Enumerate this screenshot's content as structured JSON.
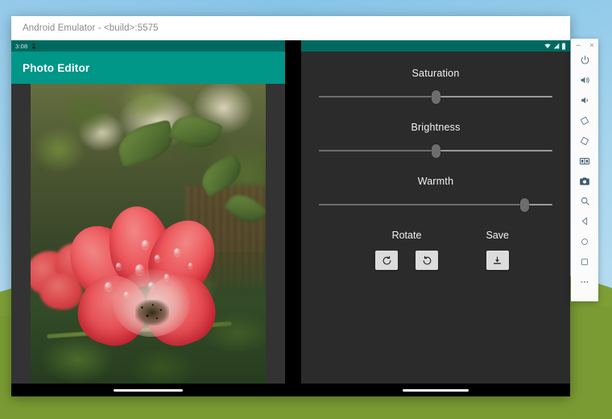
{
  "window": {
    "title": "Android Emulator - <build>:5575"
  },
  "android_status_bar": {
    "clock": "3:08",
    "left_icons": [
      "debug-bridge-icon"
    ],
    "right_icons": [
      "wifi-icon",
      "signal-icon",
      "battery-icon"
    ]
  },
  "app": {
    "appbar_title": "Photo Editor",
    "appbar_color": "#009688",
    "statusbar_color": "#00695f",
    "background_color": "#2b2b2b"
  },
  "photo": {
    "alt": "Red rose flower with water droplets on green leaves"
  },
  "controls": {
    "sliders": [
      {
        "label": "Saturation",
        "value": 50,
        "min": 0,
        "max": 100
      },
      {
        "label": "Brightness",
        "value": 50,
        "min": 0,
        "max": 100
      },
      {
        "label": "Warmth",
        "value": 88,
        "min": 0,
        "max": 100
      }
    ],
    "rotate": {
      "title": "Rotate",
      "buttons": [
        {
          "icon": "rotate-left-icon",
          "label": "Rotate left"
        },
        {
          "icon": "rotate-right-icon",
          "label": "Rotate right"
        }
      ]
    },
    "save": {
      "title": "Save",
      "buttons": [
        {
          "icon": "save-download-icon",
          "label": "Save image"
        }
      ]
    }
  },
  "emulator_toolbar": {
    "window_controls": [
      {
        "name": "minimize",
        "glyph": "–"
      },
      {
        "name": "close",
        "glyph": "✕"
      }
    ],
    "tools": [
      {
        "name": "power-icon",
        "label": "Power"
      },
      {
        "name": "volume-up-icon",
        "label": "Volume up"
      },
      {
        "name": "volume-down-icon",
        "label": "Volume down"
      },
      {
        "name": "rotate-left-icon",
        "label": "Rotate left"
      },
      {
        "name": "rotate-right-icon",
        "label": "Rotate right"
      },
      {
        "name": "fold-screen-icon",
        "label": "Fold / dual screen"
      },
      {
        "name": "camera-icon",
        "label": "Take screenshot"
      },
      {
        "name": "zoom-icon",
        "label": "Zoom mode"
      },
      {
        "name": "back-icon",
        "label": "Back"
      },
      {
        "name": "home-icon",
        "label": "Home"
      },
      {
        "name": "overview-icon",
        "label": "Overview"
      },
      {
        "name": "more-icon",
        "label": "Extended controls"
      }
    ]
  },
  "desktop": {
    "sky_color": "#93cbe9",
    "grass_color": "#7d9f36"
  }
}
